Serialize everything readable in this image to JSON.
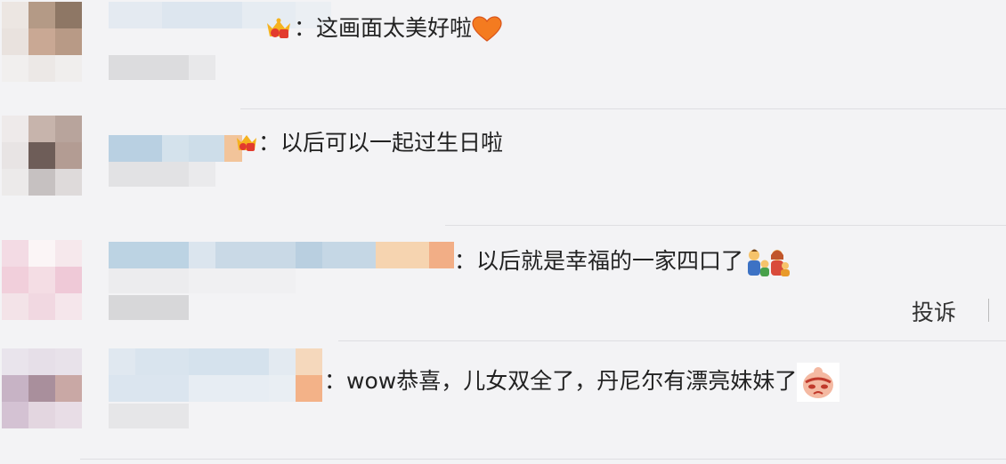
{
  "comments": [
    {
      "text": "：这画面太美好啦",
      "emoji": "heart-emoji"
    },
    {
      "text": "：以后可以一起过生日啦",
      "emoji": ""
    },
    {
      "text": "：以后就是幸福的一家四口了",
      "emoji": "family-emoji"
    },
    {
      "text": "：wow恭喜，儿女双全了，丹尼尔有漂亮妹妹了",
      "emoji": "sticker-emoji"
    }
  ],
  "report_label": "投诉",
  "colors": {
    "background": "#f3f3f5",
    "text": "#222222",
    "divider": "#dedee2"
  }
}
